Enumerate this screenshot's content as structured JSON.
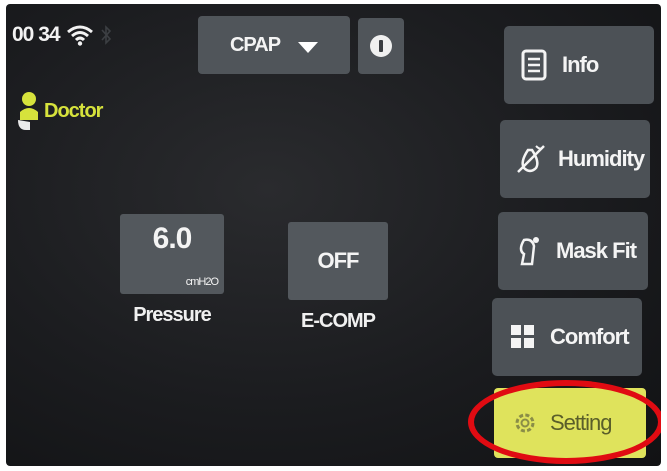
{
  "status_bar": {
    "time": "00 34",
    "wifi_icon": "wifi-icon",
    "bluetooth_icon": "bluetooth-icon"
  },
  "mode": {
    "selected": "CPAP",
    "dropdown_icon": "chevron-down-icon",
    "info_icon": "info-icon"
  },
  "user": {
    "label": "Doctor",
    "icon": "user-icon",
    "color": "#d6e23c"
  },
  "parameters": {
    "pressure": {
      "value": "6.0",
      "unit": "cmH2O",
      "caption": "Pressure"
    },
    "ecomp": {
      "value": "OFF",
      "caption": "E-COMP"
    }
  },
  "menu": [
    {
      "label": "Info",
      "icon": "document-icon"
    },
    {
      "label": "Humidity",
      "icon": "humidity-icon"
    },
    {
      "label": "Mask Fit",
      "icon": "mask-fit-icon"
    },
    {
      "label": "Comfort",
      "icon": "grid-icon"
    },
    {
      "label": "Setting",
      "icon": "gear-icon",
      "color": "#dfe35c"
    }
  ],
  "annotation": {
    "highlight_color": "#e00b12"
  }
}
